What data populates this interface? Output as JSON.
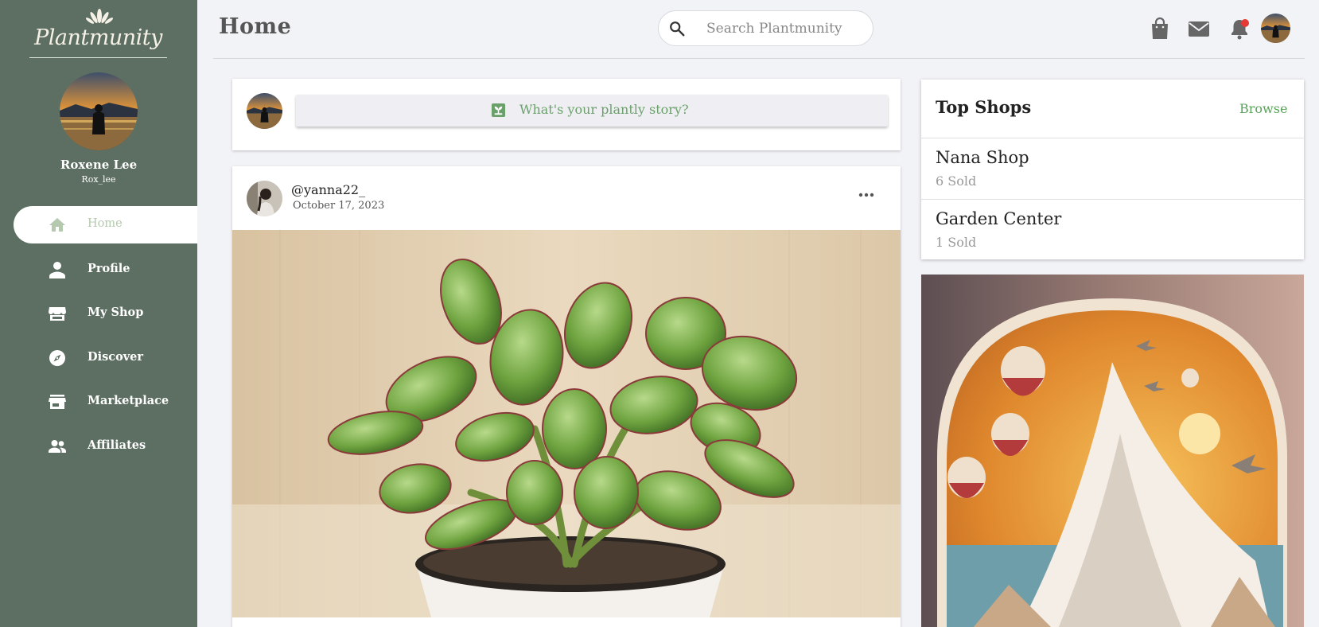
{
  "brand": {
    "name": "Plantmunity"
  },
  "user": {
    "name": "Roxene Lee",
    "handle": "Rox_lee"
  },
  "sidebar": {
    "items": [
      {
        "label": "Home",
        "icon": "home-icon",
        "active": true
      },
      {
        "label": "Profile",
        "icon": "person-icon"
      },
      {
        "label": "My Shop",
        "icon": "storefront-icon"
      },
      {
        "label": "Discover",
        "icon": "compass-icon"
      },
      {
        "label": "Marketplace",
        "icon": "store-icon"
      },
      {
        "label": "Affiliates",
        "icon": "people-icon"
      }
    ]
  },
  "header": {
    "title": "Home",
    "search_placeholder": "Search Plantmunity",
    "icons": [
      "shopping-bag-icon",
      "mail-icon",
      "bell-icon"
    ]
  },
  "composer": {
    "prompt": "What's your plantly story?"
  },
  "post": {
    "username": "@yanna22_",
    "date": "October 17, 2023"
  },
  "top_shops": {
    "title": "Top Shops",
    "browse_label": "Browse",
    "shops": [
      {
        "name": "Nana Shop",
        "sold": "6 Sold"
      },
      {
        "name": "Garden Center",
        "sold": "1 Sold"
      }
    ]
  },
  "colors": {
    "sidebar": "#5d6f62",
    "accent": "#5aa35a",
    "background": "#f2f3f7"
  }
}
